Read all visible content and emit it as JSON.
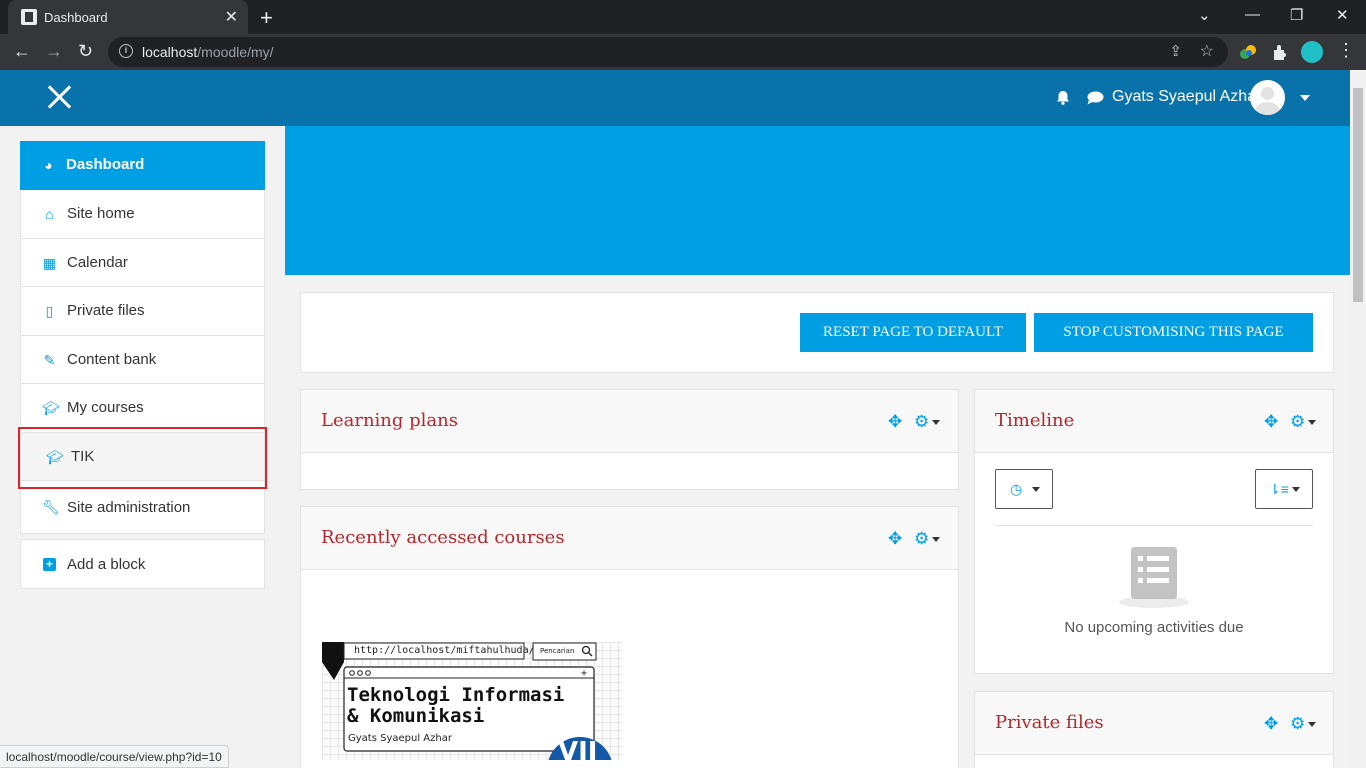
{
  "browser": {
    "tab_title": "Dashboard",
    "url_host": "localhost",
    "url_path": "/moodle/my/",
    "status_url": "localhost/moodle/course/view.php?id=10"
  },
  "navbar": {
    "username": "Gyats Syaepul Azhar"
  },
  "sidebar": {
    "items": [
      {
        "label": "Dashboard",
        "icon": "dashboard-icon"
      },
      {
        "label": "Site home",
        "icon": "home-icon"
      },
      {
        "label": "Calendar",
        "icon": "calendar-icon"
      },
      {
        "label": "Private files",
        "icon": "file-icon"
      },
      {
        "label": "Content bank",
        "icon": "brush-icon"
      },
      {
        "label": "My courses",
        "icon": "graduation-cap-icon"
      },
      {
        "label": "TIK",
        "icon": "graduation-cap-icon"
      },
      {
        "label": "Site administration",
        "icon": "wrench-icon"
      }
    ],
    "add_block": "Add a block"
  },
  "page_controls": {
    "reset_label": "RESET PAGE TO DEFAULT",
    "stop_label": "STOP CUSTOMISING THIS PAGE"
  },
  "blocks": {
    "learning_plans": "Learning plans",
    "recent_courses": "Recently accessed courses",
    "timeline": "Timeline",
    "timeline_empty": "No upcoming activities due",
    "private_files": "Private files"
  },
  "course_card": {
    "url_text": "http://localhost/miftahulhuda/",
    "search_text": "Pencarian",
    "title_line1": "Teknologi Informasi",
    "title_line2": "& Komunikasi",
    "author": "Gyats Syaepul Azhar"
  },
  "colors": {
    "brand": "#0a72aa",
    "accent": "#009ee3",
    "block_title": "#b3272b",
    "highlight_border": "#d9262c"
  }
}
